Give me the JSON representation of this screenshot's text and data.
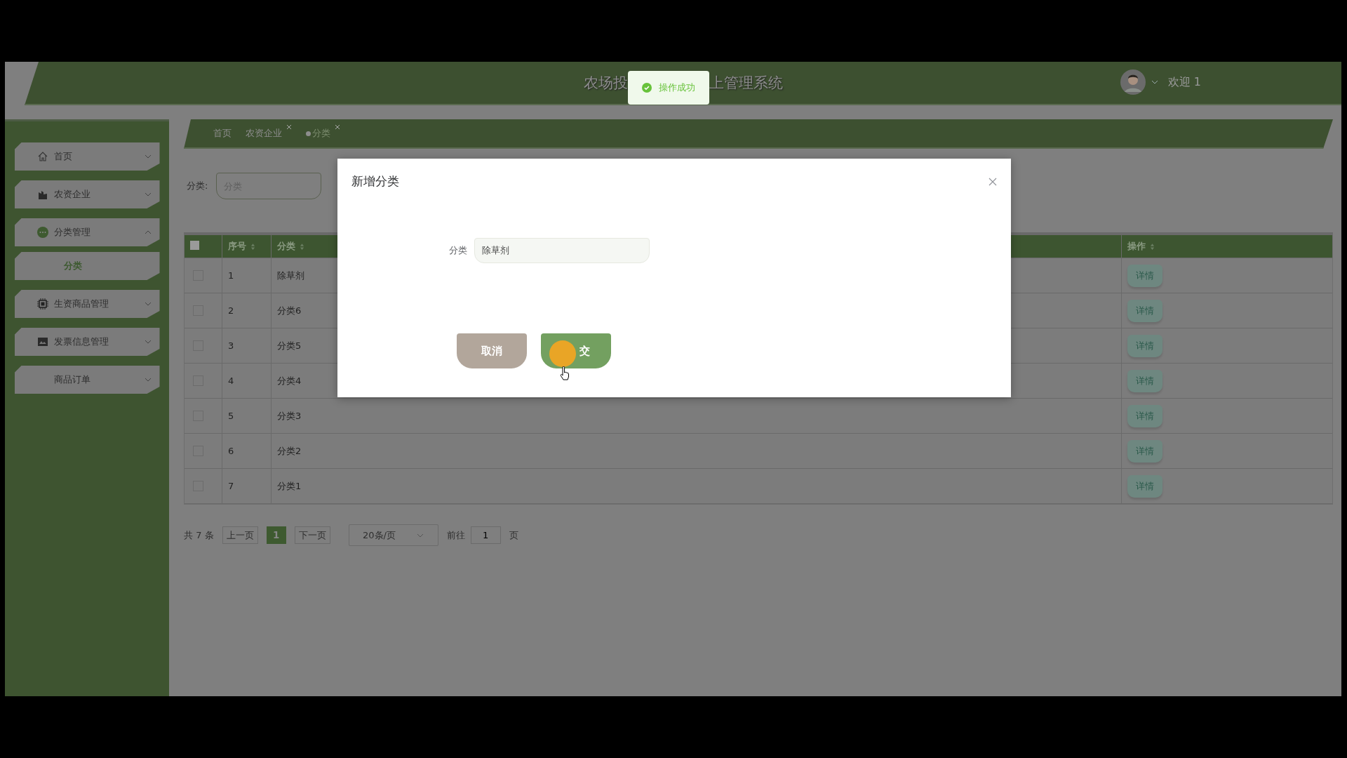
{
  "header": {
    "title_left": "农场投",
    "title_right": "上管理系统",
    "greeting": "欢迎 1"
  },
  "toast": {
    "text": "操作成功"
  },
  "sidebar": {
    "items": [
      {
        "label": "首页",
        "expanded": false
      },
      {
        "label": "农资企业",
        "expanded": false
      },
      {
        "label": "分类管理",
        "expanded": true,
        "children": [
          {
            "label": "分类"
          }
        ]
      },
      {
        "label": "生资商品管理",
        "expanded": false
      },
      {
        "label": "发票信息管理",
        "expanded": false
      },
      {
        "label": "商品订单",
        "expanded": false
      }
    ]
  },
  "breadcrumbs": [
    {
      "label": "首页",
      "closable": false,
      "selected": false
    },
    {
      "label": "农资企业",
      "closable": true,
      "selected": false
    },
    {
      "label": "分类",
      "closable": true,
      "selected": true
    }
  ],
  "search": {
    "label": "分类:",
    "placeholder": "分类"
  },
  "table": {
    "header_checked": false,
    "columns": [
      {
        "label": "序号"
      },
      {
        "label": "分类"
      },
      {
        "label": "操作"
      }
    ],
    "rows": [
      {
        "index": "1",
        "category": "除草剂",
        "action": "详情",
        "checked": false
      },
      {
        "index": "2",
        "category": "分类6",
        "action": "详情",
        "checked": false
      },
      {
        "index": "3",
        "category": "分类5",
        "action": "详情",
        "checked": false
      },
      {
        "index": "4",
        "category": "分类4",
        "action": "详情",
        "checked": false
      },
      {
        "index": "5",
        "category": "分类3",
        "action": "详情",
        "checked": false
      },
      {
        "index": "6",
        "category": "分类2",
        "action": "详情",
        "checked": false
      },
      {
        "index": "7",
        "category": "分类1",
        "action": "详情",
        "checked": false
      }
    ]
  },
  "pagination": {
    "total": "共 7 条",
    "prev": "上一页",
    "pages": [
      {
        "label": "1",
        "selected": true
      }
    ],
    "next": "下一页",
    "page_size": "20条/页",
    "goto_label": "前往",
    "goto_value": "1",
    "page_suffix": "页"
  },
  "dialog": {
    "title": "新增分类",
    "field": {
      "label": "分类",
      "value": "除草剂"
    },
    "buttons": [
      {
        "label": "取消",
        "kind": "cancel"
      },
      {
        "label": "交",
        "kind": "submit"
      }
    ]
  }
}
